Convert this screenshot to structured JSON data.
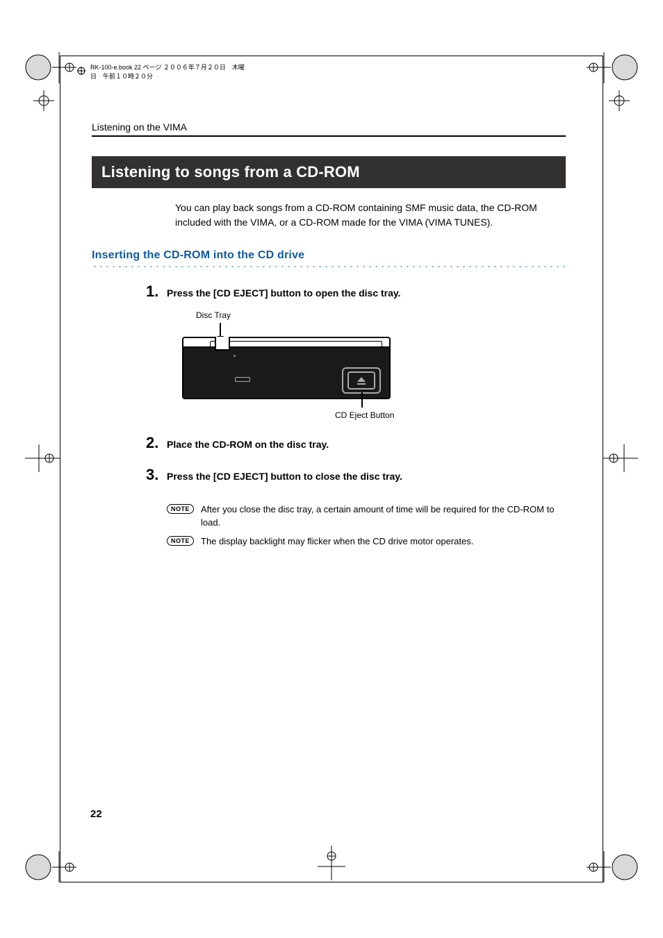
{
  "header_line": "RK-100-e.book  22 ページ  ２００６年７月２０日　木曜日　午前１０時２０分",
  "chapter_title": "Listening on the VIMA",
  "section_title": "Listening to songs from a CD-ROM",
  "intro": "You can play back songs from a CD-ROM containing SMF music data, the CD-ROM included with the VIMA, or a CD-ROM made for the VIMA (VIMA TUNES).",
  "subheading": "Inserting the CD-ROM into the CD drive",
  "steps": {
    "s1": {
      "num": "1.",
      "text": "Press the [CD EJECT] button to open the disc tray."
    },
    "s2": {
      "num": "2.",
      "text": "Place the CD-ROM on the disc tray."
    },
    "s3": {
      "num": "3.",
      "text": "Press the [CD EJECT] button to close the disc tray."
    }
  },
  "figure": {
    "disc_tray": "Disc Tray",
    "eject_button": "CD Eject Button"
  },
  "notes": {
    "badge": "NOTE",
    "n1": "After you close the disc tray, a certain amount of time will be required for the CD-ROM to load.",
    "n2": "The display backlight may flicker when the CD drive motor operates."
  },
  "page_number": "22"
}
